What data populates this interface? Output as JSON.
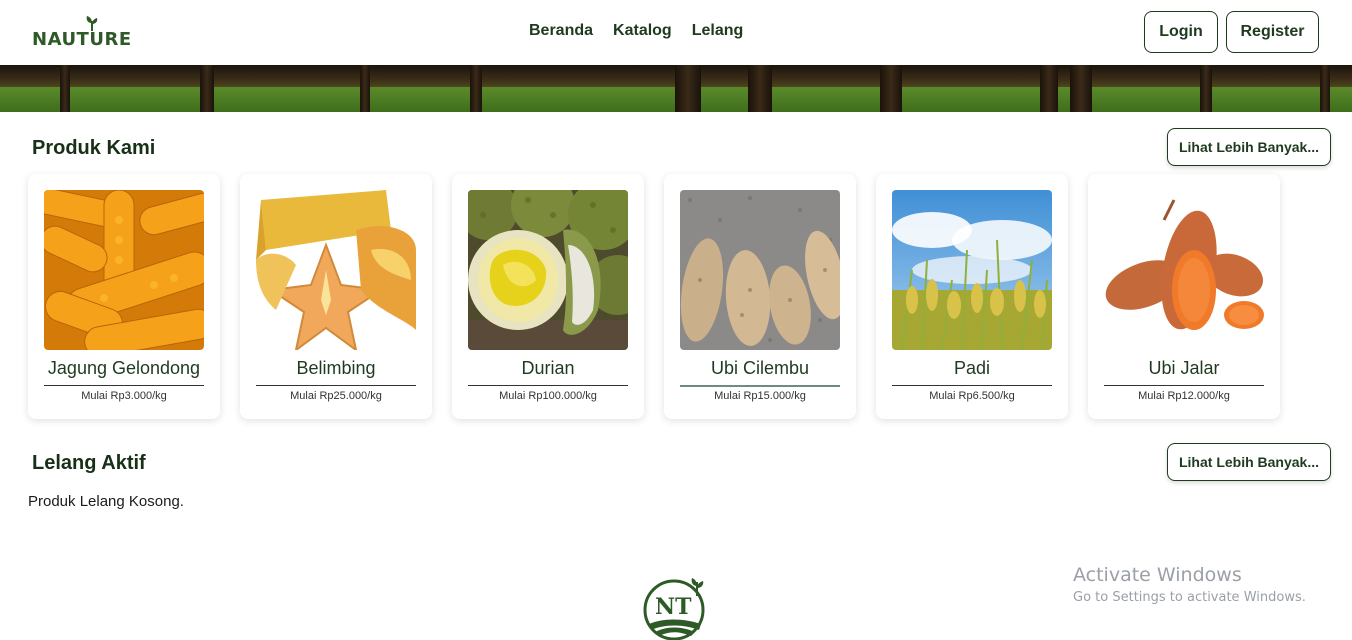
{
  "navbar": {
    "brand": "NAUTURE",
    "links": [
      "Beranda",
      "Katalog",
      "Lelang"
    ],
    "login_label": "Login",
    "register_label": "Register"
  },
  "products_section": {
    "title": "Produk Kami",
    "more_label": "Lihat Lebih Banyak..."
  },
  "products": [
    {
      "name": "Jagung Gelondong",
      "price": "Mulai Rp3.000/kg",
      "image": "corn"
    },
    {
      "name": "Belimbing",
      "price": "Mulai Rp25.000/kg",
      "image": "starfruit"
    },
    {
      "name": "Durian",
      "price": "Mulai Rp100.000/kg",
      "image": "durian"
    },
    {
      "name": "Ubi Cilembu",
      "price": "Mulai Rp15.000/kg",
      "image": "cilembu-sweet-potato"
    },
    {
      "name": "Padi",
      "price": "Mulai Rp6.500/kg",
      "image": "rice-plant"
    },
    {
      "name": "Ubi Jalar",
      "price": "Mulai Rp12.000/kg",
      "image": "sweet-potato"
    }
  ],
  "auction_section": {
    "title": "Lelang Aktif",
    "more_label": "Lihat Lebih Banyak...",
    "empty_text": "Produk Lelang Kosong."
  },
  "footer": {
    "logo_text": "NT"
  },
  "watermark": {
    "line1": "Activate Windows",
    "line2": "Go to Settings to activate Windows."
  },
  "colors": {
    "brand_green": "#2e5a27",
    "text_dark_green": "#1f3a1f"
  }
}
